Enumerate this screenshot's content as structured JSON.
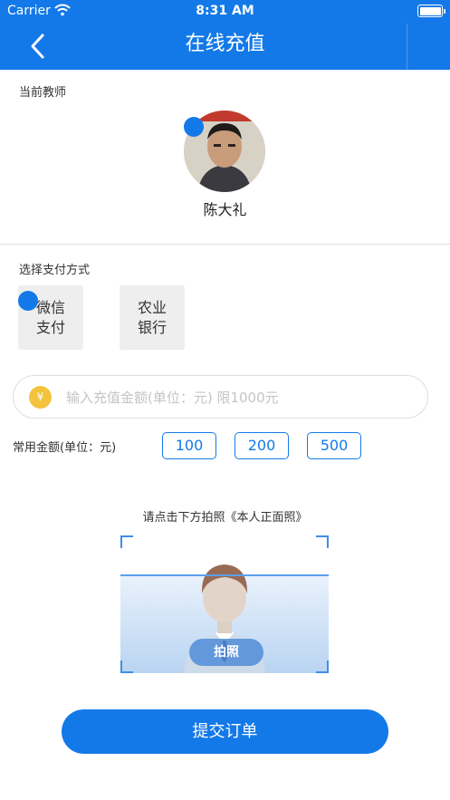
{
  "status_bar": {
    "carrier": "Carrier",
    "time": "8:31 AM"
  },
  "nav": {
    "title": "在线充值",
    "back_icon": "chevron-left-icon"
  },
  "teacher": {
    "label": "当前教师",
    "name": "陈大礼"
  },
  "payment": {
    "label": "选择支付方式",
    "methods": [
      {
        "line1": "微信",
        "line2": "支付",
        "selected": true
      },
      {
        "line1": "农业",
        "line2": "银行",
        "selected": false
      }
    ]
  },
  "amount": {
    "currency_symbol": "¥",
    "value": "",
    "placeholder": "输入充值金额(单位：元) 限1000元"
  },
  "quick_amounts": {
    "label": "常用金额(单位：元)",
    "options": [
      "100",
      "200",
      "500"
    ]
  },
  "photo": {
    "title": "请点击下方拍照《本人正面照》",
    "button_label": "拍照"
  },
  "submit": {
    "label": "提交订单"
  },
  "colors": {
    "primary": "#1479e8",
    "yen_badge": "#f3c33d",
    "chip_border": "#1479e8"
  }
}
